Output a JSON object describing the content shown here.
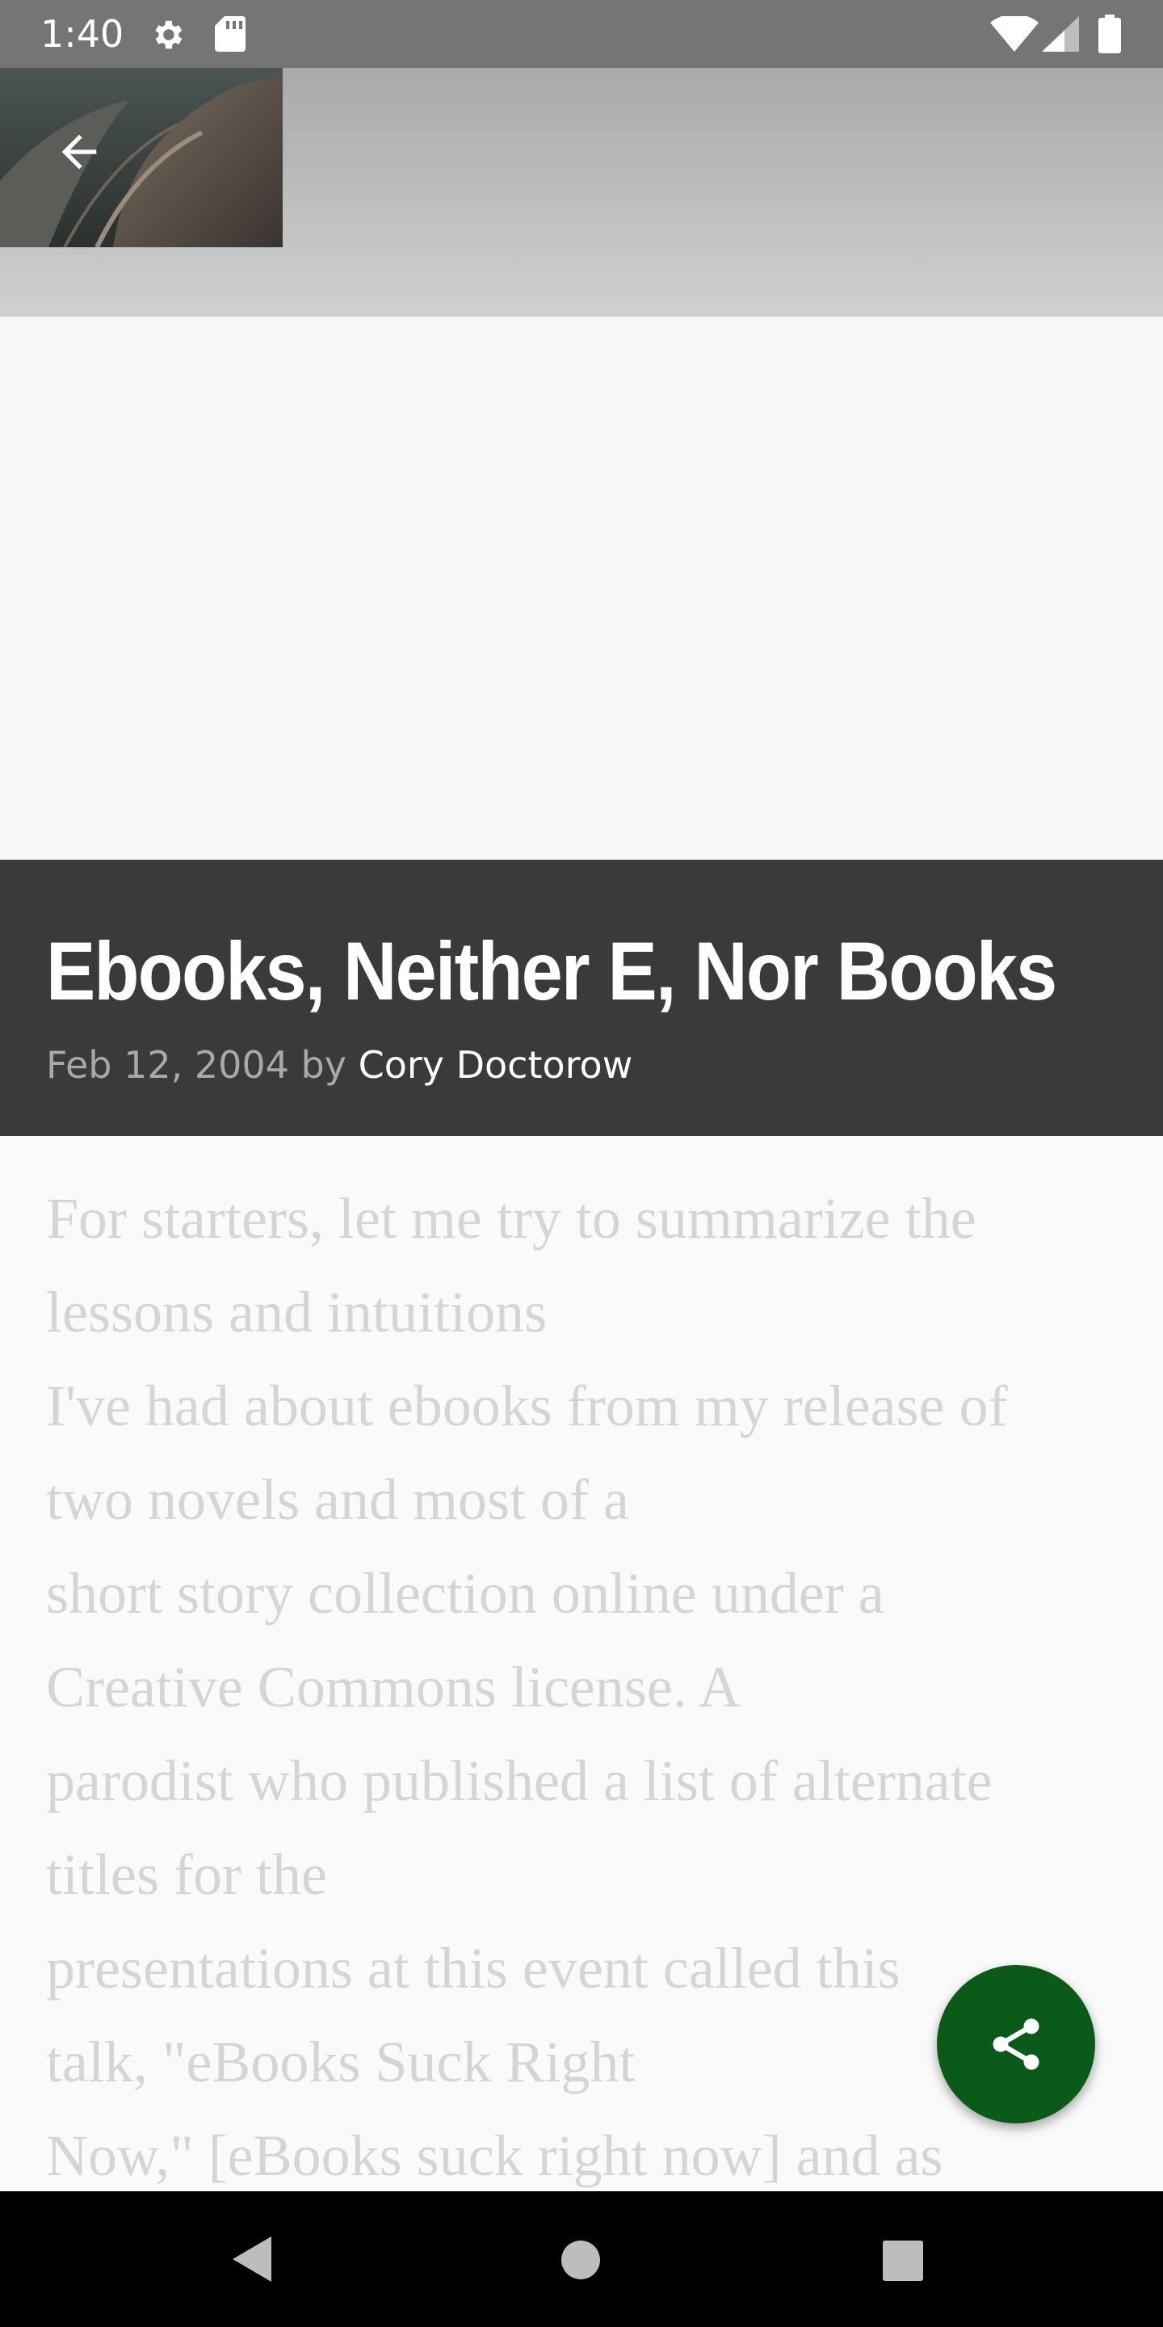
{
  "status_bar": {
    "time": "1:40",
    "icons": [
      "gear-icon",
      "sd-card-icon",
      "wifi-icon",
      "signal-icon",
      "battery-icon"
    ]
  },
  "header": {
    "back_icon": "arrow-back-icon"
  },
  "article": {
    "title": "Ebooks, Neither E, Nor Books",
    "date": "Feb 12, 2004",
    "by": "by",
    "author": "Cory Doctorow",
    "body_lines": [
      "For starters, let me try to summarize the",
      "lessons and intuitions",
      "I've had about ebooks from my release of",
      "two novels and most of a",
      "short story collection online under a",
      "Creative Commons license. A",
      "parodist who published a list of alternate",
      "titles for the",
      "presentations at this event called this",
      "talk, \"eBooks Suck Right",
      "Now,\" [eBooks suck right now] and as"
    ]
  },
  "fab": {
    "icon": "share-icon"
  },
  "nav": {
    "back": "back-triangle-icon",
    "home": "home-circle-icon",
    "recents": "recents-square-icon"
  },
  "colors": {
    "status_bar": "#757575",
    "title_band": "#3a3a3a",
    "fab": "#0b5a1a",
    "body_text": "#d5d5d5"
  }
}
